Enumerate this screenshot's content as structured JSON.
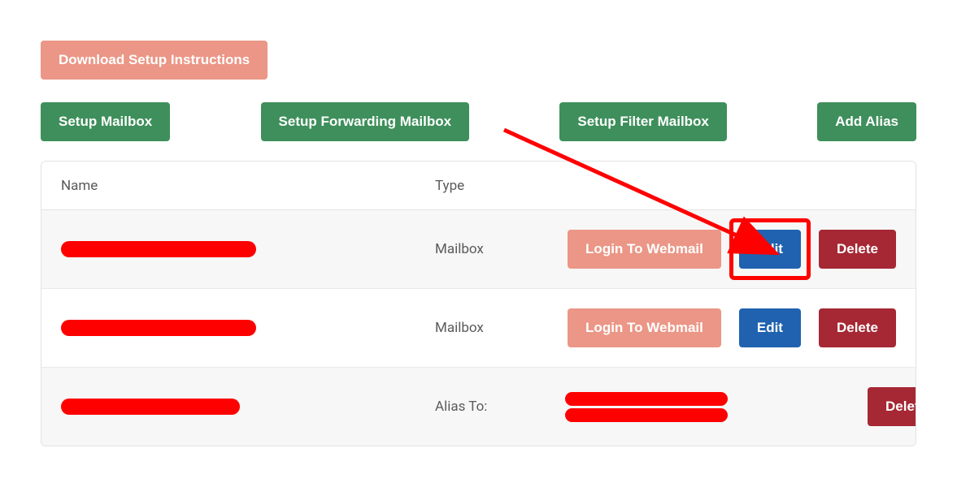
{
  "buttons": {
    "download_instructions": "Download Setup Instructions",
    "setup_mailbox": "Setup Mailbox",
    "setup_forwarding": "Setup Forwarding Mailbox",
    "setup_filter": "Setup Filter Mailbox",
    "add_alias": "Add Alias"
  },
  "table": {
    "headers": {
      "name": "Name",
      "type": "Type"
    },
    "rows": [
      {
        "type": "Mailbox",
        "actions": {
          "login_webmail": "Login To Webmail",
          "edit": "Edit",
          "delete": "Delete"
        },
        "highlighted_edit": true
      },
      {
        "type": "Mailbox",
        "actions": {
          "login_webmail": "Login To Webmail",
          "edit": "Edit",
          "delete": "Delete"
        },
        "highlighted_edit": false
      },
      {
        "type": "Alias To:",
        "actions": {
          "delete": "Delete"
        },
        "highlighted_edit": false
      }
    ]
  }
}
